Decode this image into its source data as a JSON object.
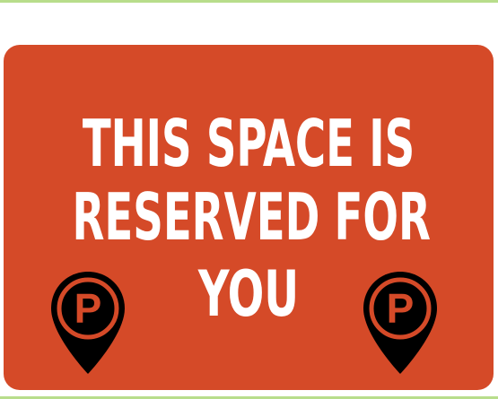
{
  "sign": {
    "line_1": "THIS SPACE IS",
    "line_2": "RESERVED FOR",
    "line_3": "YOU",
    "colors": {
      "background": "#d54a28",
      "text": "#ffffff",
      "pin": "#000000"
    },
    "icons": [
      {
        "name": "parking-location-pin-icon",
        "letter": "P"
      },
      {
        "name": "parking-location-pin-icon",
        "letter": "P"
      }
    ]
  }
}
